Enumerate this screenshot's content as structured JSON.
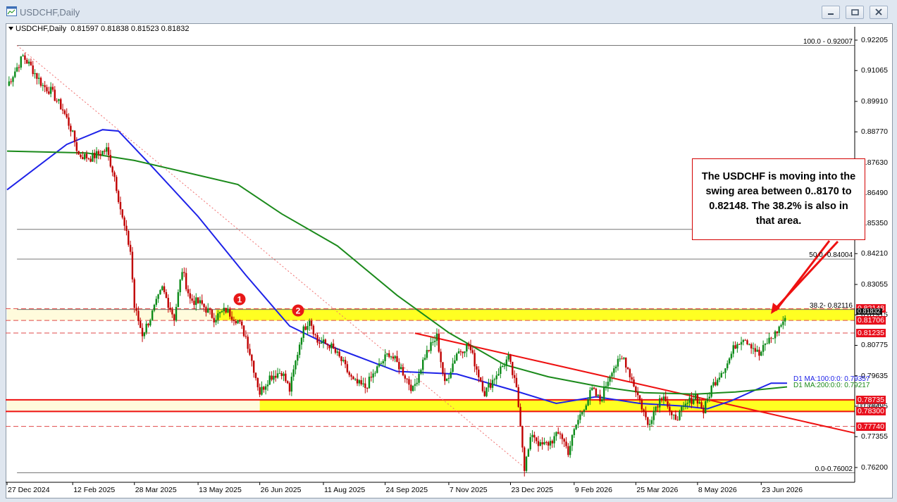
{
  "window": {
    "title": "USDCHF,Daily"
  },
  "chart_info": {
    "ohlc_header": "USDCHF,Daily  0.81597 0.81838 0.81523 0.81832"
  },
  "annotation": {
    "text": "The USDCHF is moving into the swing area between 0..8170 to 0.82148. The 38.2% is also in that area."
  },
  "markers": [
    {
      "label": "1"
    },
    {
      "label": "2"
    }
  ],
  "fib_levels": [
    {
      "label": "100.0 - 0.92007",
      "price": 0.92007
    },
    {
      "label": "50.0 -0.84004",
      "price": 0.84004
    },
    {
      "label": "38.2- 0.82116",
      "price": 0.82116
    },
    {
      "label": "0.0-0.76002",
      "price": 0.76002
    }
  ],
  "ma_labels": {
    "ma100": "D1 MA:100:0:0: 0.79357",
    "ma200": "D1 MA:200:0:0: 0.79217"
  },
  "price_tags": [
    {
      "text": "0.82148",
      "price": 0.82148,
      "color": "#e8101d"
    },
    {
      "text": "0.81706",
      "price": 0.81706,
      "color": "#e8101d"
    },
    {
      "text": "0.81235",
      "price": 0.81235,
      "color": "#e8101d"
    },
    {
      "text": "0.78735",
      "price": 0.78735,
      "color": "#e8101d"
    },
    {
      "text": "0.78300",
      "price": 0.783,
      "color": "#e8101d"
    },
    {
      "text": "0.77740",
      "price": 0.7774,
      "color": "#e8101d"
    }
  ],
  "overlap_tags": {
    "current": "0.81832",
    "current_price": 0.81832,
    "ma": "0.78495",
    "ma_price": 0.78495
  },
  "colors": {
    "bull": "#0b8a18",
    "bear": "#c00000",
    "ma100": "#1e22e8",
    "ma200": "#1b8a1b",
    "zone": "#ffff22",
    "trend": "#ee1111",
    "annotation_border": "#d30000"
  },
  "chart_data": {
    "type": "candlestick",
    "title": "USDCHF,Daily",
    "ylim": [
      0.7574,
      0.9243
    ],
    "y_ticks": [
      "0.92205",
      "0.91065",
      "0.89910",
      "0.88770",
      "0.87630",
      "0.86490",
      "0.85350",
      "0.84210",
      "0.83055",
      "0.81915",
      "0.80775",
      "0.79635",
      "0.78495",
      "0.77355",
      "0.76200"
    ],
    "x_tick_labels": [
      "27 Dec 2024",
      "12 Feb 2025",
      "28 Mar 2025",
      "13 May 2025",
      "26 Jun 2025",
      "11 Aug 2025",
      "24 Sep 2025",
      "7 Nov 2025",
      "23 Dec 2025",
      "9 Feb 2026",
      "25 Mar 2026",
      "8 May 2026",
      "23 Jun 2026"
    ],
    "x_tick_index": [
      0,
      33,
      64,
      96,
      127,
      159,
      190,
      222,
      253,
      285,
      316,
      347,
      379
    ],
    "bars_total": 392,
    "close_path": [
      [
        0,
        0.905
      ],
      [
        8,
        0.916
      ],
      [
        12,
        0.912
      ],
      [
        18,
        0.905
      ],
      [
        22,
        0.903
      ],
      [
        28,
        0.896
      ],
      [
        32,
        0.889
      ],
      [
        36,
        0.879
      ],
      [
        42,
        0.878
      ],
      [
        50,
        0.881
      ],
      [
        54,
        0.871
      ],
      [
        58,
        0.855
      ],
      [
        62,
        0.843
      ],
      [
        64,
        0.822
      ],
      [
        68,
        0.812
      ],
      [
        72,
        0.818
      ],
      [
        78,
        0.829
      ],
      [
        84,
        0.818
      ],
      [
        88,
        0.836
      ],
      [
        92,
        0.825
      ],
      [
        98,
        0.823
      ],
      [
        104,
        0.818
      ],
      [
        110,
        0.821
      ],
      [
        116,
        0.817
      ],
      [
        120,
        0.811
      ],
      [
        124,
        0.799
      ],
      [
        127,
        0.79
      ],
      [
        132,
        0.796
      ],
      [
        138,
        0.798
      ],
      [
        142,
        0.791
      ],
      [
        148,
        0.812
      ],
      [
        152,
        0.818
      ],
      [
        156,
        0.809
      ],
      [
        162,
        0.808
      ],
      [
        168,
        0.802
      ],
      [
        174,
        0.794
      ],
      [
        180,
        0.792
      ],
      [
        186,
        0.799
      ],
      [
        192,
        0.805
      ],
      [
        198,
        0.799
      ],
      [
        204,
        0.791
      ],
      [
        210,
        0.804
      ],
      [
        216,
        0.811
      ],
      [
        220,
        0.793
      ],
      [
        226,
        0.805
      ],
      [
        232,
        0.808
      ],
      [
        236,
        0.799
      ],
      [
        240,
        0.79
      ],
      [
        246,
        0.797
      ],
      [
        252,
        0.803
      ],
      [
        256,
        0.791
      ],
      [
        258,
        0.779
      ],
      [
        260,
        0.762
      ],
      [
        264,
        0.775
      ],
      [
        268,
        0.77
      ],
      [
        272,
        0.771
      ],
      [
        278,
        0.775
      ],
      [
        282,
        0.768
      ],
      [
        286,
        0.778
      ],
      [
        290,
        0.785
      ],
      [
        294,
        0.791
      ],
      [
        298,
        0.787
      ],
      [
        304,
        0.799
      ],
      [
        310,
        0.803
      ],
      [
        314,
        0.795
      ],
      [
        318,
        0.787
      ],
      [
        322,
        0.778
      ],
      [
        326,
        0.785
      ],
      [
        330,
        0.79
      ],
      [
        334,
        0.78
      ],
      [
        338,
        0.782
      ],
      [
        342,
        0.786
      ],
      [
        346,
        0.789
      ],
      [
        350,
        0.783
      ],
      [
        354,
        0.792
      ],
      [
        358,
        0.797
      ],
      [
        362,
        0.801
      ],
      [
        366,
        0.808
      ],
      [
        370,
        0.811
      ],
      [
        374,
        0.808
      ],
      [
        378,
        0.804
      ],
      [
        382,
        0.809
      ],
      [
        386,
        0.812
      ],
      [
        391,
        0.818
      ]
    ],
    "series": [
      {
        "name": "D1 MA:100:0:0: 0.79357",
        "points": [
          [
            0,
            0.866
          ],
          [
            30,
            0.883
          ],
          [
            48,
            0.8885
          ],
          [
            56,
            0.888
          ],
          [
            70,
            0.877
          ],
          [
            96,
            0.856
          ],
          [
            120,
            0.834
          ],
          [
            142,
            0.815
          ],
          [
            164,
            0.807
          ],
          [
            196,
            0.798
          ],
          [
            226,
            0.797
          ],
          [
            254,
            0.791
          ],
          [
            276,
            0.786
          ],
          [
            296,
            0.7885
          ],
          [
            318,
            0.786
          ],
          [
            340,
            0.785
          ],
          [
            352,
            0.784
          ],
          [
            364,
            0.787
          ],
          [
            376,
            0.791
          ],
          [
            384,
            0.7936
          ],
          [
            392,
            0.7936
          ]
        ]
      },
      {
        "name": "D1 MA:200:0:0: 0.79217",
        "points": [
          [
            0,
            0.8805
          ],
          [
            40,
            0.8798
          ],
          [
            64,
            0.877
          ],
          [
            90,
            0.8725
          ],
          [
            116,
            0.868
          ],
          [
            138,
            0.857
          ],
          [
            166,
            0.845
          ],
          [
            196,
            0.8265
          ],
          [
            222,
            0.8125
          ],
          [
            250,
            0.8005
          ],
          [
            272,
            0.796
          ],
          [
            298,
            0.7923
          ],
          [
            320,
            0.79
          ],
          [
            346,
            0.7895
          ],
          [
            366,
            0.7903
          ],
          [
            384,
            0.7916
          ],
          [
            392,
            0.7922
          ]
        ]
      }
    ],
    "horizontal_lines": [
      0.92007,
      0.84004,
      0.82116,
      0.76002,
      0.8512
    ],
    "zones": [
      {
        "from_index": 0,
        "to_price": 0.82148,
        "from_price": 0.81706,
        "start_index": 105
      },
      {
        "to_price": 0.78735,
        "from_price": 0.783,
        "start_index": 0
      }
    ],
    "trendlines": [
      {
        "from": [
          205,
          0.8123
        ],
        "to": [
          392,
          0.7749
        ],
        "color": "red"
      },
      {
        "from": [
          5,
          0.92007
        ],
        "to": [
          260,
          0.762
        ],
        "style": "dotted-red"
      }
    ]
  }
}
